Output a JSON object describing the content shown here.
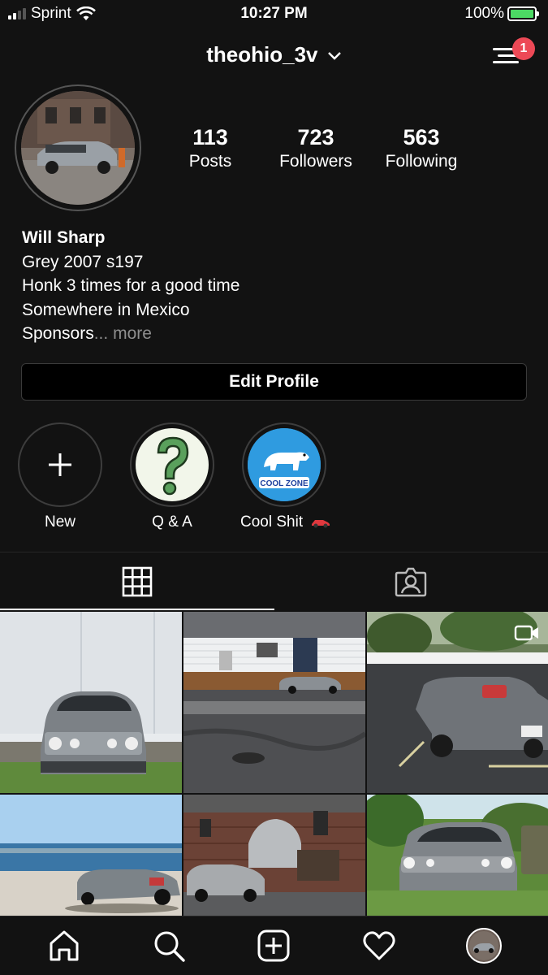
{
  "status_bar": {
    "carrier": "Sprint",
    "time": "10:27 PM",
    "battery": "100%"
  },
  "header": {
    "username": "theohio_3v",
    "notification_count": "1"
  },
  "profile": {
    "stats": [
      {
        "value": "113",
        "label": "Posts"
      },
      {
        "value": "723",
        "label": "Followers"
      },
      {
        "value": "563",
        "label": "Following"
      }
    ],
    "bio": {
      "name": "Will Sharp",
      "line1": "Grey 2007 s197",
      "line2": "Honk 3 times for a good time",
      "line3": "Somewhere in Mexico",
      "line4": "Sponsors",
      "ellipsis": "...",
      "more": "more"
    },
    "edit_profile_label": "Edit Profile"
  },
  "highlights": [
    {
      "label": "New",
      "icon": "plus-icon"
    },
    {
      "label": "Q & A",
      "icon": "question-mark-icon"
    },
    {
      "label": "Cool Shit",
      "icon": "polar-bear-icon",
      "badge_text": "COOL ZONE"
    }
  ],
  "tabs": [
    {
      "name": "grid",
      "icon": "grid-icon",
      "active": true
    },
    {
      "name": "tagged",
      "icon": "tagged-person-icon",
      "active": false
    }
  ],
  "bottom_nav": [
    {
      "icon": "home-icon"
    },
    {
      "icon": "search-icon"
    },
    {
      "icon": "new-post-icon"
    },
    {
      "icon": "heart-icon"
    },
    {
      "icon": "profile-avatar-icon"
    }
  ],
  "colors": {
    "background": "#121212",
    "badge": "#ed4956",
    "muted_text": "#8e8e8e",
    "battery": "#4cd964"
  }
}
